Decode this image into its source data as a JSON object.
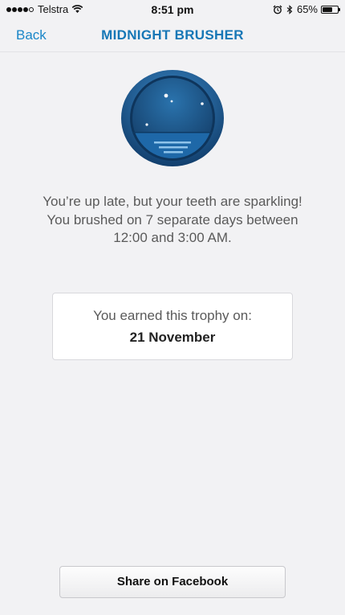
{
  "status_bar": {
    "carrier": "Telstra",
    "time": "8:51 pm",
    "battery_percent": "65%",
    "battery_level": 0.65,
    "signal_bars": 4,
    "signal_total": 5
  },
  "nav": {
    "back_label": "Back",
    "title": "MIDNIGHT BRUSHER"
  },
  "trophy": {
    "icon": "moon-badge-icon",
    "description": "You’re up late, but your teeth are sparkling! You brushed on 7 separate days between 12:00 and 3:00 AM.",
    "earned_label": "You earned this trophy on:",
    "earned_date": "21 November"
  },
  "share": {
    "label": "Share on Facebook"
  },
  "colors": {
    "accent": "#1677b6",
    "badge_blue": "#1c5f96",
    "background": "#f2f2f4"
  }
}
